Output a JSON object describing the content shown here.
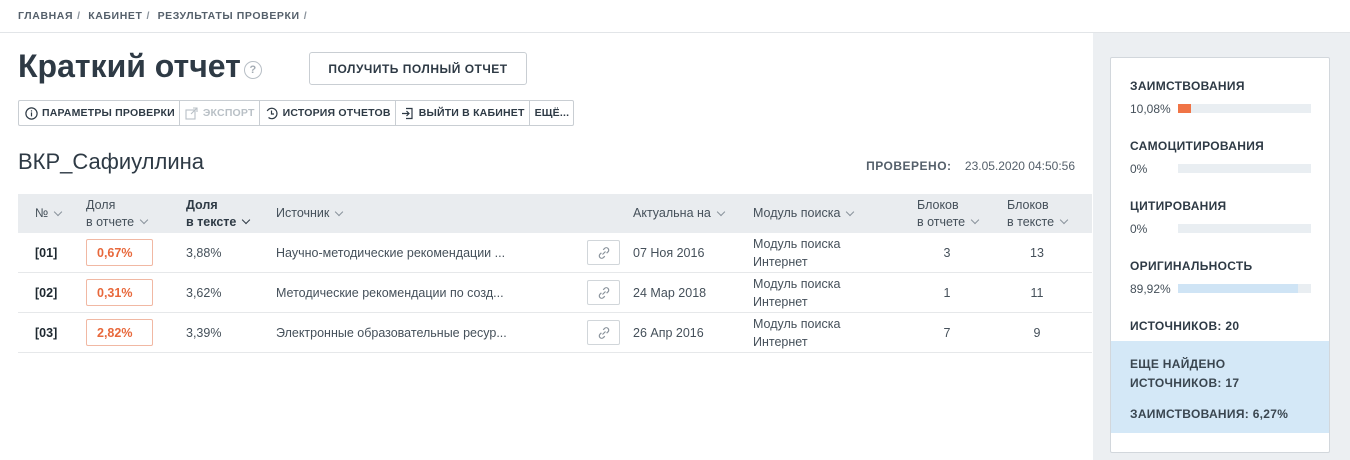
{
  "breadcrumb": [
    "ГЛАВНАЯ",
    "КАБИНЕТ",
    "РЕЗУЛЬТАТЫ ПРОВЕРКИ"
  ],
  "header": {
    "title": "Краткий отчет",
    "full_report_label": "ПОЛУЧИТЬ ПОЛНЫЙ ОТЧЕТ"
  },
  "toolbar": {
    "params_label": "ПАРАМЕТРЫ ПРОВЕРКИ",
    "export_label": "ЭКСПОРТ",
    "history_label": "ИСТОРИЯ ОТЧЕТОВ",
    "exit_label": "ВЫЙТИ В КАБИНЕТ",
    "more_label": "ЕЩЁ..."
  },
  "document": {
    "name": "ВКР_Сафиуллина",
    "checked_label": "ПРОВЕРЕНО:",
    "checked_value": "23.05.2020 04:50:56"
  },
  "table": {
    "headers": {
      "num": "№",
      "share_report_1": "Доля",
      "share_report_2": "в отчете",
      "share_text_1": "Доля",
      "share_text_2": "в тексте",
      "source": "Источник",
      "actual": "Актуальна на",
      "module": "Модуль поиска",
      "blocks_report_1": "Блоков",
      "blocks_report_2": "в отчете",
      "blocks_text_1": "Блоков",
      "blocks_text_2": "в тексте"
    },
    "rows": [
      {
        "num": "[01]",
        "share_report": "0,67%",
        "share_text": "3,88%",
        "source": "Научно-методические рекомендации ...",
        "date": "07 Ноя 2016",
        "module_1": "Модуль поиска",
        "module_2": "Интернет",
        "blocks_report": "3",
        "blocks_text": "13"
      },
      {
        "num": "[02]",
        "share_report": "0,31%",
        "share_text": "3,62%",
        "source": "Методические рекомендации по созд...",
        "date": "24 Мар 2018",
        "module_1": "Модуль поиска",
        "module_2": "Интернет",
        "blocks_report": "1",
        "blocks_text": "11"
      },
      {
        "num": "[03]",
        "share_report": "2,82%",
        "share_text": "3,39%",
        "source": "Электронные образовательные ресур...",
        "date": "26 Апр 2016",
        "module_1": "Модуль поиска",
        "module_2": "Интернет",
        "blocks_report": "7",
        "blocks_text": "9"
      }
    ]
  },
  "sidebar": {
    "borrowing_label": "ЗАИМСТВОВАНИЯ",
    "borrowing_value": "10,08%",
    "borrowing_fraction": 0.1008,
    "selfcite_label": "САМОЦИТИРОВАНИЯ",
    "selfcite_value": "0%",
    "selfcite_fraction": 0,
    "cite_label": "ЦИТИРОВАНИЯ",
    "cite_value": "0%",
    "cite_fraction": 0,
    "original_label": "ОРИГИНАЛЬНОСТЬ",
    "original_value": "89,92%",
    "original_fraction": 0.8992,
    "sources_label": "ИСТОЧНИКОВ:",
    "sources_value": "20",
    "more_found_1": "ЕЩЕ НАЙДЕНО",
    "more_found_2_label": "ИСТОЧНИКОВ:",
    "more_found_2_value": "17",
    "more_borrow_label": "ЗАИМСТВОВАНИЯ:",
    "more_borrow_value": "6,27%"
  },
  "colors": {
    "borrowing": "#f07446",
    "original": "#cfe4f5",
    "accent_share": "#e8683b"
  }
}
